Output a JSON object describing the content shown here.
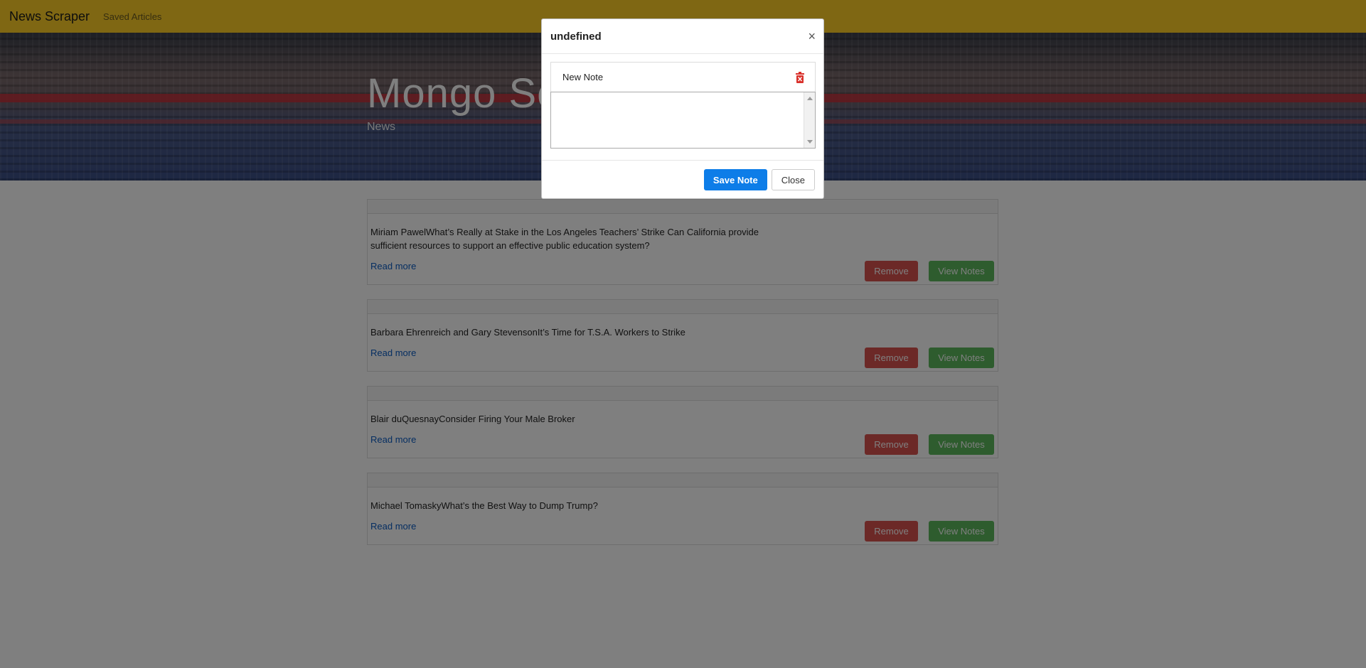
{
  "navbar": {
    "brand": "News Scraper",
    "links": [
      "Saved Articles"
    ]
  },
  "hero": {
    "title": "Mongo Scraper",
    "subtitle": "News"
  },
  "articles": [
    {
      "title": "Miriam PawelWhat’s Really at Stake in the Los Angeles Teachers’ Strike Can California provide sufficient resources to support an effective public education system?",
      "link": "Read more",
      "remove": "Remove",
      "notes": "View Notes"
    },
    {
      "title": "Barbara Ehrenreich and Gary StevensonIt’s Time for T.S.A. Workers to Strike",
      "link": "Read more",
      "remove": "Remove",
      "notes": "View Notes"
    },
    {
      "title": "Blair duQuesnayConsider Firing Your Male Broker",
      "link": "Read more",
      "remove": "Remove",
      "notes": "View Notes"
    },
    {
      "title": "Michael TomaskyWhat’s the Best Way to Dump Trump?",
      "link": "Read more",
      "remove": "Remove",
      "notes": "View Notes"
    }
  ],
  "modal": {
    "title": "undefined",
    "close_symbol": "×",
    "note_label": "New Note",
    "textarea_value": "",
    "save_label": "Save Note",
    "close_label": "Close"
  },
  "colors": {
    "navbar": "#fecf27",
    "remove_button": "#d9534f",
    "notes_button": "#5cb85c",
    "save_button": "#0d7de8",
    "link": "#0b5cc4",
    "trash_icon": "#d9312b"
  }
}
